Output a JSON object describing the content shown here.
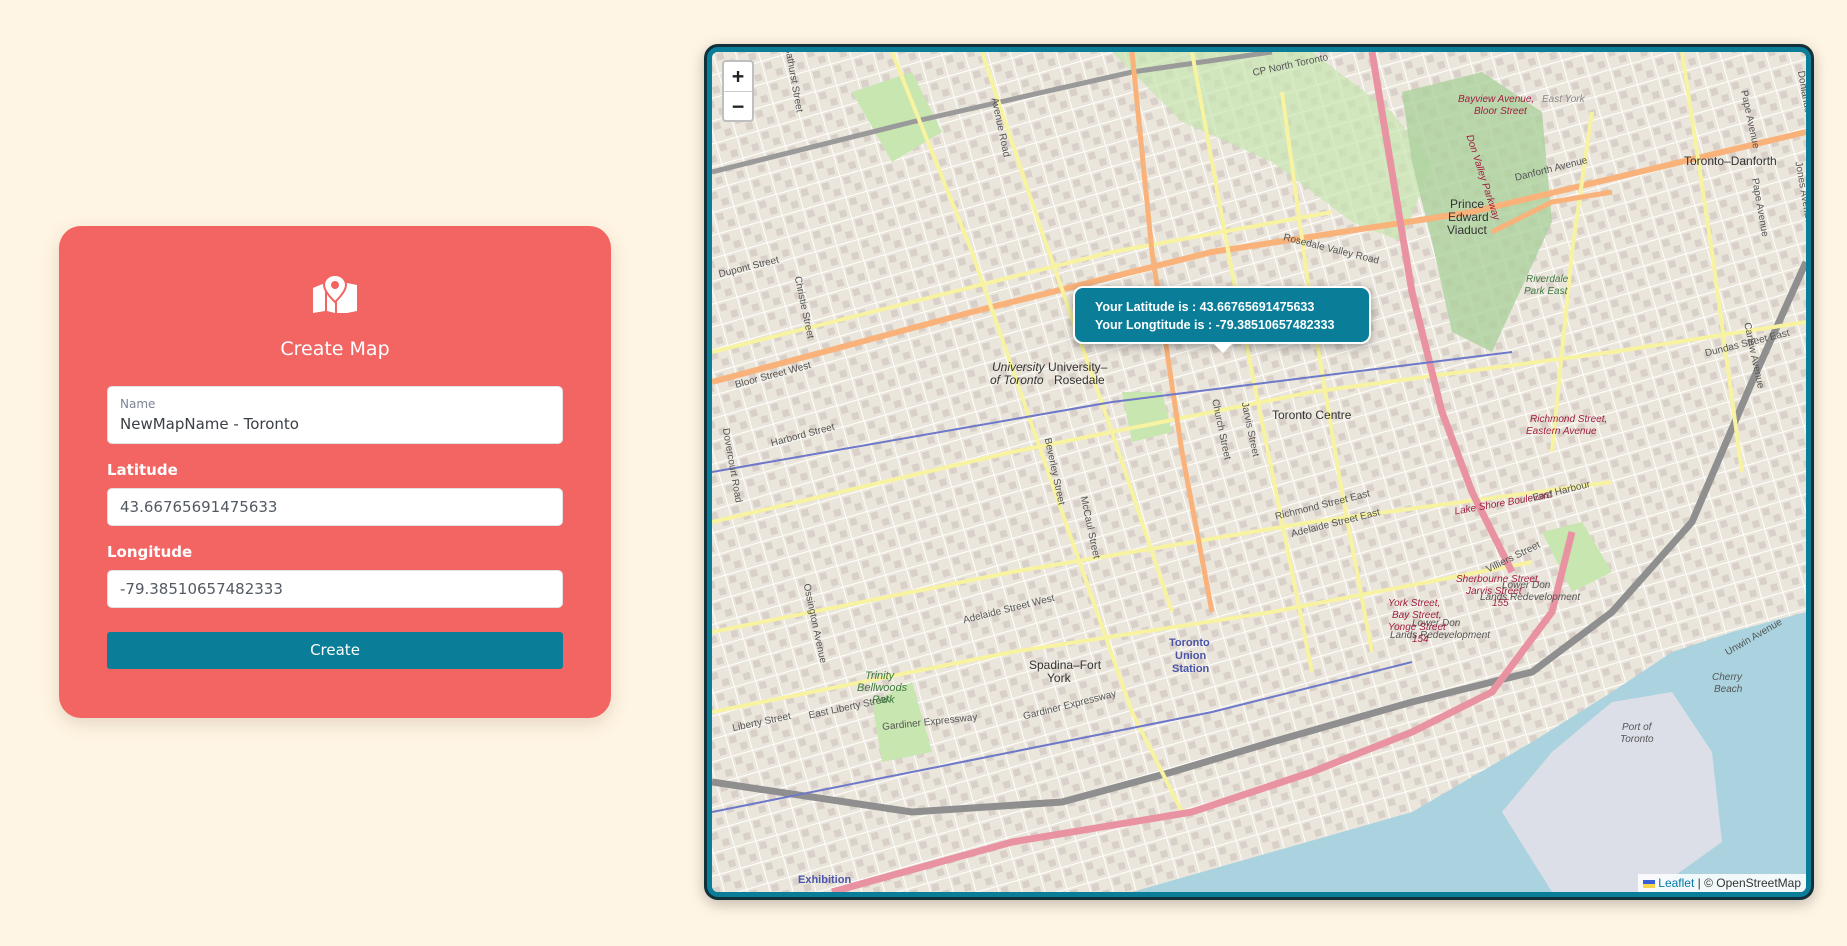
{
  "form": {
    "title": "Create Map",
    "icon": "map-marker-icon",
    "name_label": "Name",
    "name_value": "NewMapName - Toronto",
    "latitude_label": "Latitude",
    "latitude_value": "43.66765691475633",
    "longitude_label": "Longitude",
    "longitude_value": "-79.38510657482333",
    "create_label": "Create"
  },
  "map": {
    "zoom_in": "+",
    "zoom_out": "−",
    "popup": {
      "lat_line": "Your Latitude is : 43.66765691475633",
      "lng_line": "Your Longtitude is : -79.38510657482333"
    },
    "attribution": {
      "leaflet": "Leaflet",
      "separator": " | © ",
      "osm": "OpenStreetMap"
    },
    "labels": {
      "toronto_danforth": "Toronto–Danforth",
      "prince_edward": "Prince",
      "prince_edward_2": "Edward",
      "prince_edward_3": "Viaduct",
      "university_of": "University",
      "university_of_2": "of Toronto",
      "university_rosedale": "University–",
      "university_rosedale_2": "Rosedale",
      "toronto_centre": "Toronto Centre",
      "spadina_fort_york": "Spadina–Fort",
      "spadina_fort_york_2": "York",
      "union_station": "Toronto",
      "union_station_2": "Union",
      "union_station_3": "Station",
      "dupont_street": "Dupont Street",
      "bloor_street_west": "Bloor Street West",
      "harbord_street": "Harbord Street",
      "rosedale_valley_road": "Rosedale Valley Road",
      "danforth_avenue": "Danforth Avenue",
      "dundas_street_east": "Dundas Street East",
      "richmond_street_east": "Richmond Street East",
      "adelaide_street_east": "Adelaide Street East",
      "adelaide_street_west": "Adelaide Street West",
      "gardiner_expressway": "Gardiner Expressway",
      "gardiner_expressway_2": "Gardiner Expressway",
      "east_liberty_street": "East Liberty Street",
      "liberty_street": "Liberty Street",
      "lake_shore_boulevard": "Lake Shore Boulevard",
      "east_harbour": "East Harbour",
      "lower_don_lands": "Lower Don",
      "lower_don_lands_2": "Lands Redevelopment",
      "lower_don_lands_3": "Lower Don",
      "lower_don_lands_4": "Lands Redevelopment",
      "villiers_street": "Villiers Street",
      "cherry_beach": "Cherry",
      "cherry_beach_2": "Beach",
      "port_of_toronto": "Port of",
      "port_of_toronto_2": "Toronto",
      "trinity_bellwoods": "Trinity",
      "trinity_bellwoods_2": "Bellwoods",
      "trinity_bellwoods_3": "Park",
      "exhibition": "Exhibition",
      "riverdale_park_east": "Riverdale",
      "riverdale_park_east_2": "Park East",
      "bayview_bloor": "Bayview Avenue,",
      "bayview_bloor_2": "Bloor Street",
      "richmond_eastern": "Richmond Street,",
      "richmond_eastern_2": "Eastern Avenue",
      "york_bay_yonge": "York Street,",
      "york_bay_yonge_2": "Bay Street,",
      "york_bay_yonge_3": "Yonge Street",
      "york_bay_yonge_4": "154",
      "sherbourne_jarvis": "Sherbourne Street,",
      "sherbourne_jarvis_2": "Jarvis Street",
      "sherbourne_jarvis_3": "155",
      "don_valley_parkway": "Don Valley Parkway",
      "cp_north_toronto": "CP North Toronto",
      "east_york": "East York",
      "christie_street": "Christie Street",
      "ossington_avenue": "Ossington Avenue",
      "beverley_street": "Beverley Street",
      "mccaul_street": "McCaul Street",
      "church_street": "Church Street",
      "jarvis_street": "Jarvis Street",
      "avenue_road": "Avenue Road",
      "pape_avenue": "Pape Avenue",
      "jones_avenue": "Jones Avenue",
      "carlaw_avenue": "Carlaw Avenue",
      "unwin_avenue": "Unwin Avenue",
      "dovercourt_road": "Dovercourt Road",
      "bathurst_street": "Bathurst Street",
      "donlands_avenue": "Donlands Avenue"
    }
  }
}
